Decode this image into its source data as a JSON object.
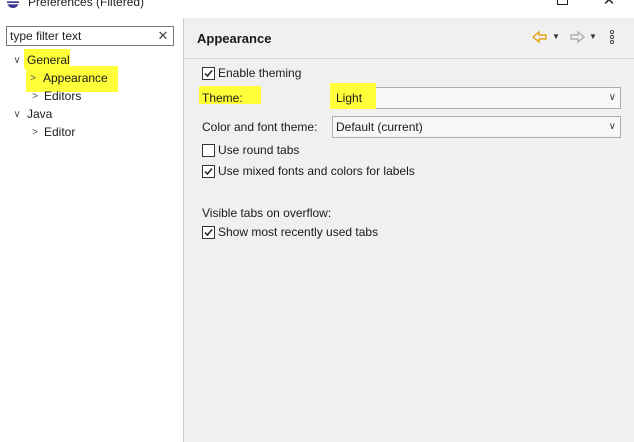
{
  "window": {
    "title": "Preferences (Filtered)"
  },
  "filter": {
    "placeholder": "type filter text",
    "value": ""
  },
  "tree": {
    "general": "General",
    "appearance": "Appearance",
    "editors": "Editors",
    "java": "Java",
    "editor": "Editor"
  },
  "page": {
    "title": "Appearance",
    "enable_theming": {
      "label": "Enable theming",
      "checked": true
    },
    "theme": {
      "label": "Theme:",
      "value": "Light"
    },
    "color_font_theme": {
      "label": "Color and font theme:",
      "value": "Default (current)"
    },
    "round_tabs": {
      "label": "Use round tabs",
      "checked": false
    },
    "mixed_fonts": {
      "label": "Use mixed fonts and colors for labels",
      "checked": true
    },
    "visible_tabs_label": "Visible tabs on overflow:",
    "show_recent_tabs": {
      "label": "Show most recently used tabs",
      "checked": true
    }
  },
  "colors": {
    "highlight": "#ffff3a",
    "pane_background": "#f0f0f0",
    "back_arrow": "#e8a317",
    "forward_arrow": "#b0b0b0"
  }
}
